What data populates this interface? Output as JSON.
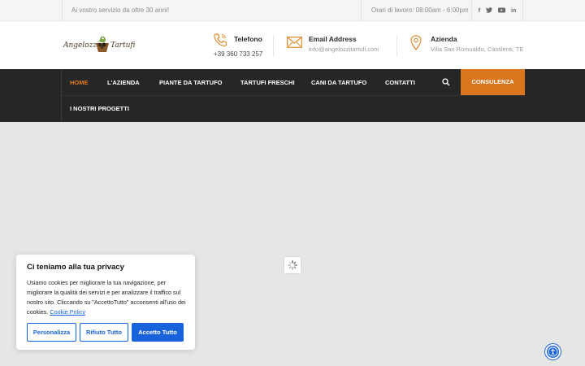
{
  "topbar": {
    "tagline": "Ai vostro servizio da oltre 30 anni!",
    "hours": "Orari di lavoro: 08:00am - 6:00pm",
    "social": [
      "f",
      "t",
      "yt",
      "in"
    ]
  },
  "logo": {
    "word1": "Angelozzi",
    "word2": "Tartufi"
  },
  "contacts": {
    "phone": {
      "title": "Telefono",
      "value": "+39 360 733 257",
      "icon": "phone-icon"
    },
    "email": {
      "title": "Email Address",
      "value": "info@angelozzitartufi.com",
      "icon": "envelope-icon"
    },
    "address": {
      "title": "Azienda",
      "value": "Villa San Romualdo, Castilenti, TE",
      "icon": "map-pin-icon"
    }
  },
  "nav": {
    "items": [
      "HOME",
      "L'AZIENDA",
      "PIANTE DA TARTUFO",
      "TARTUFI FRESCHI",
      "CANI DA TARTUFO",
      "CONTATTI",
      "I NOSTRI PROGETTI"
    ],
    "active": "HOME",
    "cta": "CONSULENZA",
    "accent": "#d9761e"
  },
  "cookie": {
    "title": "Ci teniamo alla tua privacy",
    "text": "Usiamo cookies per migliorare la tua navigazione, per migliorare la qualità dei servizi e per analizzare il traffico sul nostro sito. Cliccando su \"AccettoTutto\" acconsenti all'uso dei cookies.",
    "policy_link": "Cookie Policy",
    "btn_customize": "Personalizza",
    "btn_reject": "Rifiuto Tutto",
    "btn_accept": "Accetto Tutto",
    "accent": "#1863dc"
  }
}
